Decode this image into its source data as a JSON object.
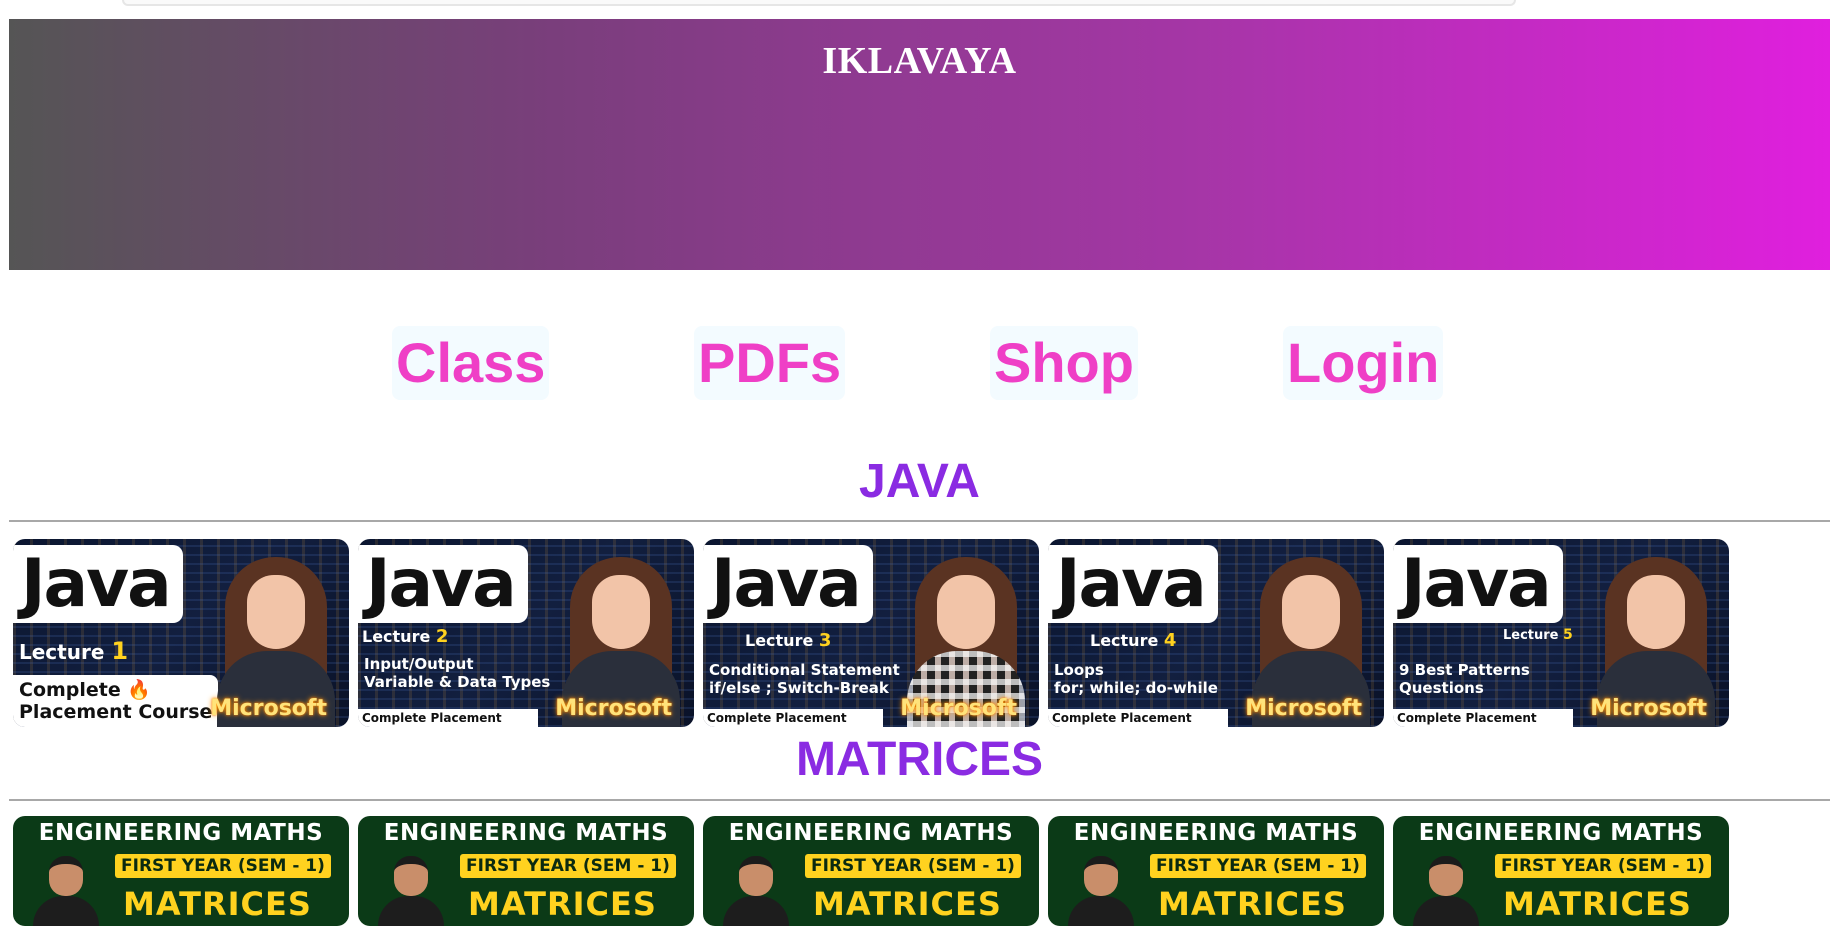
{
  "site": {
    "title": "IKLAVAYA"
  },
  "nav": {
    "items": [
      "Class",
      "PDFs",
      "Shop",
      "Login"
    ]
  },
  "sections": [
    {
      "title": "JAVA",
      "thumbnails": [
        {
          "word": "Java",
          "lecture_label": "Lecture",
          "lecture_number": "1",
          "topic_lines": [
            "Complete 🔥",
            "Placement Course"
          ],
          "brand": "Microsoft"
        },
        {
          "word": "Java",
          "lecture_label": "Lecture",
          "lecture_number": "2",
          "topic_lines": [
            "Input/Output",
            "Variable & Data Types"
          ],
          "footer": "Complete Placement Course",
          "brand": "Microsoft"
        },
        {
          "word": "Java",
          "lecture_label": "Lecture",
          "lecture_number": "3",
          "topic_lines": [
            "Conditional Statement",
            "if/else ; Switch-Break"
          ],
          "footer": "Complete Placement Course",
          "brand": "Microsoft"
        },
        {
          "word": "Java",
          "lecture_label": "Lecture",
          "lecture_number": "4",
          "topic_lines": [
            "Loops",
            "for; while; do-while"
          ],
          "footer": "Complete Placement Course",
          "brand": "Microsoft"
        },
        {
          "word": "Java",
          "lecture_label": "Lecture",
          "lecture_number": "5",
          "topic_lines": [
            "9 Best Patterns",
            "Questions"
          ],
          "footer": "Complete Placement Course",
          "brand": "Microsoft"
        }
      ]
    },
    {
      "title": "MATRICES",
      "thumbnails": [
        {
          "heading": "ENGINEERING MATHS",
          "year": "FIRST YEAR (SEM - 1)",
          "subject": "MATRICES"
        },
        {
          "heading": "ENGINEERING MATHS",
          "year": "FIRST YEAR (SEM - 1)",
          "subject": "MATRICES"
        },
        {
          "heading": "ENGINEERING MATHS",
          "year": "FIRST YEAR (SEM - 1)",
          "subject": "MATRICES"
        },
        {
          "heading": "ENGINEERING MATHS",
          "year": "FIRST YEAR (SEM - 1)",
          "subject": "MATRICES"
        },
        {
          "heading": "ENGINEERING MATHS",
          "year": "FIRST YEAR (SEM - 1)",
          "subject": "MATRICES"
        }
      ]
    }
  ],
  "colors": {
    "nav_link": "#ef3fc6",
    "section_title": "#8a2be2",
    "hero_gradient_start": "#555555",
    "hero_gradient_end": "#e01fde"
  }
}
